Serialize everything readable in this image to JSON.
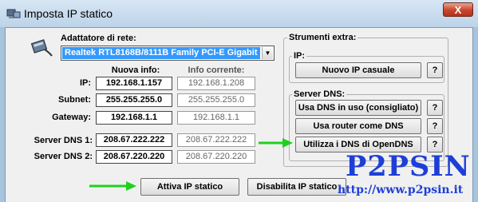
{
  "window": {
    "title": "Imposta IP statico",
    "close_label": "X"
  },
  "adapter": {
    "label": "Adattatore di rete:",
    "selected": "Realtek RTL8168B/8111B Family PCI-E Gigabit"
  },
  "columns": {
    "new": "Nuova info:",
    "current": "Info corrente:"
  },
  "rows": [
    {
      "label": "IP:",
      "new": "192.168.1.157",
      "current": "192.168.1.208"
    },
    {
      "label": "Subnet:",
      "new": "255.255.255.0",
      "current": "255.255.255.0"
    },
    {
      "label": "Gateway:",
      "new": "192.168.1.1",
      "current": "192.168.1.1"
    },
    {
      "label": "Server DNS 1:",
      "new": "208.67.222.222",
      "current": "208.67.222.222"
    },
    {
      "label": "Server DNS 2:",
      "new": "208.67.220.220",
      "current": "208.67.220.220"
    }
  ],
  "tools": {
    "title": "Strumenti extra:",
    "ip_group": "IP:",
    "random_ip": "Nuovo IP casuale",
    "dns_group": "Server DNS:",
    "dns_in_use": "Usa DNS in uso (consigliato)",
    "router_dns": "Usa router come DNS",
    "opendns": "Utilizza i DNS di OpenDNS",
    "help": "?"
  },
  "actions": {
    "activate": "Attiva IP statico",
    "disable": "Disabilita IP statico"
  },
  "watermark": {
    "brand": "P2PSIN",
    "url": "http://www.p2psin.it"
  },
  "colors": {
    "arrow": "#1fd11f",
    "selection": "#3399ff",
    "watermark": "#1d3fd8"
  }
}
